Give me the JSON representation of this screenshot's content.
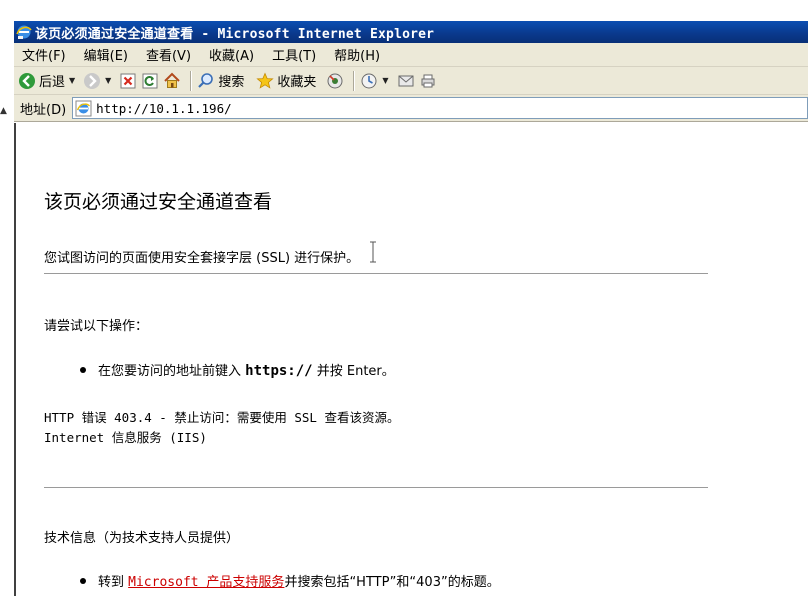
{
  "window": {
    "title": "该页必须通过安全通道查看 - Microsoft Internet Explorer",
    "accent_color": "#0a3a8e"
  },
  "menu": {
    "items": [
      "文件(F)",
      "编辑(E)",
      "查看(V)",
      "收藏(A)",
      "工具(T)",
      "帮助(H)"
    ]
  },
  "toolbar": {
    "back_label": "后退",
    "search_label": "搜索",
    "favorites_label": "收藏夹"
  },
  "address": {
    "label": "地址(D)",
    "value": "http://10.1.1.196/"
  },
  "content": {
    "heading": "该页必须通过安全通道查看",
    "intro": "您试图访问的页面使用安全套接字层 (SSL) 进行保护。",
    "try_heading": "请尝试以下操作：",
    "bullet1_pre": "在您要访问的地址前键入",
    "bullet1_code": "https://",
    "bullet1_post": "并按 Enter。",
    "error_line": "HTTP 错误 403.4 - 禁止访问：需要使用 SSL 查看该资源。",
    "iis_line": "Internet 信息服务 (IIS)",
    "tech_heading": "技术信息（为技术支持人员提供）",
    "bullet2_pre": "转到",
    "bullet2_link": "Microsoft 产品支持服务",
    "bullet2_post": "并搜索包括“HTTP”和“403”的标题。",
    "link_color": "#cc0000"
  }
}
